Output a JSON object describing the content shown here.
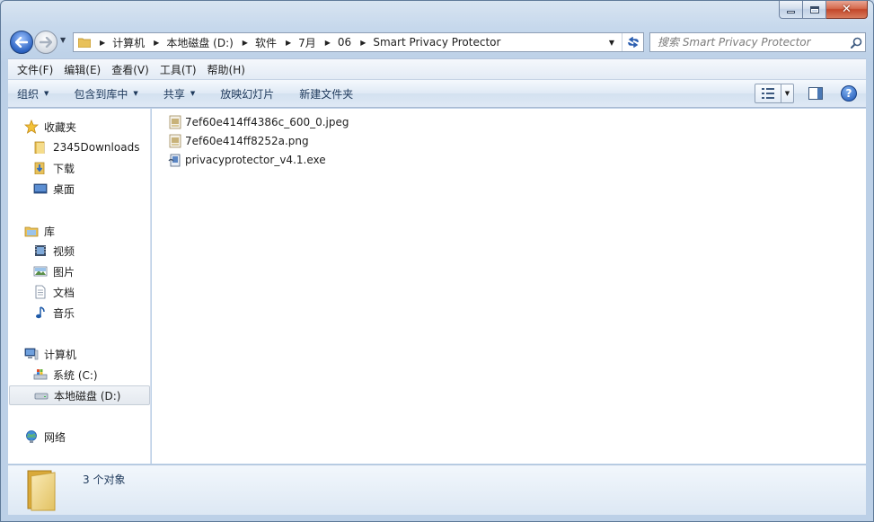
{
  "window": {
    "caption": {
      "minimize": "",
      "maximize": "",
      "close": "✕"
    }
  },
  "nav": {
    "back_icon": "back-arrow-icon",
    "forward_icon": "forward-arrow-icon",
    "breadcrumbs": [
      "计算机",
      "本地磁盘 (D:)",
      "软件",
      "7月",
      "06",
      "Smart Privacy Protector"
    ],
    "refresh_icon": "refresh-icon"
  },
  "search": {
    "placeholder": "搜索 Smart Privacy Protector",
    "value": ""
  },
  "menu": [
    "文件(F)",
    "编辑(E)",
    "查看(V)",
    "工具(T)",
    "帮助(H)"
  ],
  "commands": [
    {
      "label": "组织",
      "dropdown": true
    },
    {
      "label": "包含到库中",
      "dropdown": true
    },
    {
      "label": "共享",
      "dropdown": true
    },
    {
      "label": "放映幻灯片",
      "dropdown": false
    },
    {
      "label": "新建文件夹",
      "dropdown": false
    }
  ],
  "sidebar": {
    "favorites": {
      "label": "收藏夹",
      "items": [
        "2345Downloads",
        "下载",
        "桌面"
      ]
    },
    "libraries": {
      "label": "库",
      "items": [
        "视频",
        "图片",
        "文档",
        "音乐"
      ]
    },
    "computer": {
      "label": "计算机",
      "items": [
        "系统 (C:)",
        "本地磁盘 (D:)"
      ],
      "selected": "本地磁盘 (D:)"
    },
    "network": {
      "label": "网络"
    }
  },
  "files": [
    {
      "name": "7ef60e414ff4386c_600_0.jpeg",
      "icon": "image-file-icon"
    },
    {
      "name": "7ef60e414ff8252a.png",
      "icon": "image-file-icon"
    },
    {
      "name": "privacyprotector_v4.1.exe",
      "icon": "installer-icon"
    }
  ],
  "details": {
    "count_text": "3 个对象"
  },
  "colors": {
    "accent": "#1e395b",
    "window_frame": "#c6d8ec",
    "selection": "#e4e9ef"
  }
}
